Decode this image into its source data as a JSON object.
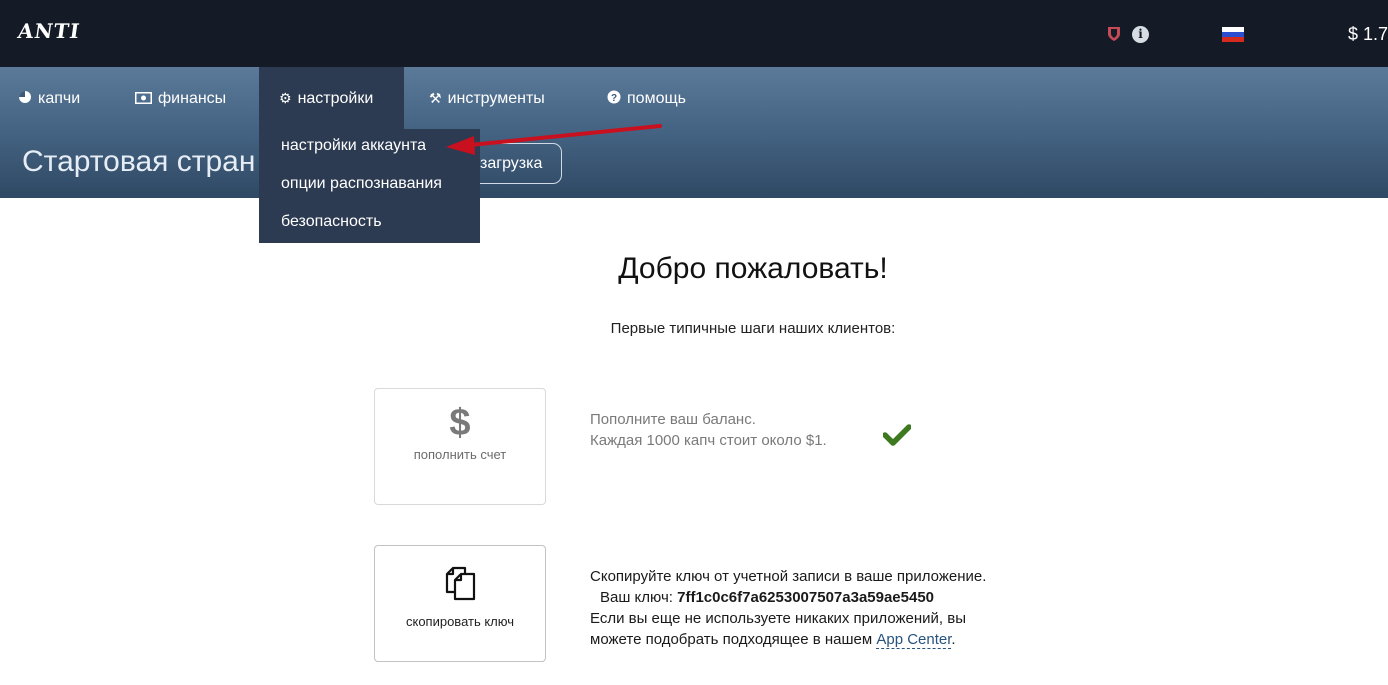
{
  "header": {
    "logo_text": "ANTI",
    "balance": "$ 1.7",
    "icons": [
      "shield-icon",
      "info-icon",
      "russia-flag-icon"
    ]
  },
  "nav": {
    "items": [
      {
        "label": "капчи",
        "icon": "pie-chart-icon"
      },
      {
        "label": "финансы",
        "icon": "banknote-icon"
      },
      {
        "label": "настройки",
        "icon": "gear-icon",
        "active": true
      },
      {
        "label": "инструменты",
        "icon": "tools-icon"
      },
      {
        "label": "помощь",
        "icon": "question-icon"
      }
    ]
  },
  "dropdown": {
    "items": [
      {
        "label": "настройки аккаунта"
      },
      {
        "label": "опции распознавания"
      },
      {
        "label": "безопасность"
      }
    ]
  },
  "page": {
    "title": "Стартовая стран",
    "upload_label": "загрузка"
  },
  "welcome": {
    "title": "Добро пожаловать!",
    "subtitle": "Первые типичные шаги наших клиентов:"
  },
  "steps": [
    {
      "card_label": "пополнить счет",
      "card_icon": "dollar-icon",
      "line1": "Пополните ваш баланс.",
      "line2": "Каждая 1000 капч стоит около $1.",
      "done": true
    },
    {
      "card_label": "скопировать ключ",
      "card_icon": "copy-icon",
      "line1": "Скопируйте ключ от учетной записи в ваше приложение.",
      "key_label": "Ваш ключ:",
      "key_value": "7ff1c0c6f7a6253007507a3a59ae5450",
      "line3": "Если вы еще не используете никаких приложений, вы",
      "line4_prefix": "можете подобрать подходящее в нашем",
      "link": "App Center",
      "line4_suffix": "."
    }
  ],
  "colors": {
    "topbar": "#151b26",
    "nav_active": "#2c3b51",
    "arrow": "#c8101f",
    "check": "#3d7a1f",
    "link": "#27537d"
  }
}
